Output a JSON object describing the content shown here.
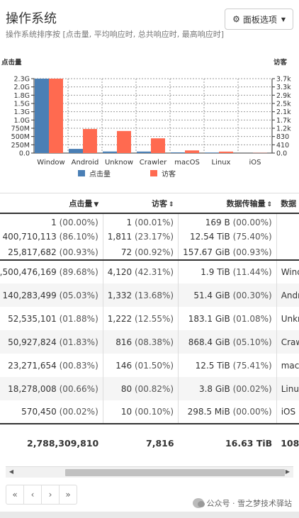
{
  "header": {
    "title": "操作系统",
    "subtitle": "操作系统排序按 [点击量, 平均响应时, 总共响应时, 最高响应时]",
    "options_label": "面板选项"
  },
  "chart_data": {
    "type": "bar",
    "categories": [
      "Window",
      "Android",
      "Unknow",
      "Crawler",
      "macOS",
      "Linux",
      "iOS"
    ],
    "series": [
      {
        "name": "点击量",
        "axis": "left",
        "color": "#4a7fb5",
        "values": [
          2500476169,
          140283499,
          52535101,
          50927824,
          23271654,
          18278008,
          570450
        ]
      },
      {
        "name": "访客",
        "axis": "right",
        "color": "#ff6a50",
        "values": [
          4120,
          1332,
          1222,
          816,
          146,
          80,
          10
        ]
      }
    ],
    "left_axis": {
      "label": "点击量",
      "ticks": [
        "0.0",
        "250M",
        "500M",
        "750M",
        "1.0G",
        "1.3G",
        "1.5G",
        "1.8G",
        "2.0G",
        "2.3G"
      ],
      "max": 2500000000
    },
    "right_axis": {
      "label": "访客",
      "ticks": [
        "0.0",
        "410",
        "830",
        "1.2k",
        "1.7k",
        "2.1k",
        "2.5k",
        "2.9k",
        "3.3k",
        "3.7k"
      ],
      "max": 4120
    },
    "legend_position": "bottom",
    "grid": true
  },
  "table": {
    "headers": {
      "hits": "点击量",
      "visitors": "访客",
      "bandwidth": "数据传输量",
      "data": "数据"
    },
    "group_rows": [
      {
        "hits": "1",
        "hits_pct": "(00.00%)",
        "visitors": "1",
        "visitors_pct": "(00.01%)",
        "bw": "169 B",
        "bw_pct": "(00.00%)",
        "data": "—"
      },
      {
        "hits": "400,710,113",
        "hits_pct": "(86.10%)",
        "visitors": "1,811",
        "visitors_pct": "(23.17%)",
        "bw": "12.54 TiB",
        "bw_pct": "(75.40%)",
        "data": "—"
      },
      {
        "hits": "25,817,682",
        "hits_pct": "(00.93%)",
        "visitors": "72",
        "visitors_pct": "(00.92%)",
        "bw": "157.67 GiB",
        "bw_pct": "(00.93%)",
        "data": "—"
      }
    ],
    "rows": [
      {
        "hits": "2,500,476,169",
        "hits_pct": "(89.68%)",
        "visitors": "4,120",
        "visitors_pct": "(42.31%)",
        "bw": "1.9 TiB",
        "bw_pct": "(11.44%)",
        "os": "Windows"
      },
      {
        "hits": "140,283,499",
        "hits_pct": "(05.03%)",
        "visitors": "1,332",
        "visitors_pct": "(13.68%)",
        "bw": "51.4 GiB",
        "bw_pct": "(00.30%)",
        "os": "Android"
      },
      {
        "hits": "52,535,101",
        "hits_pct": "(01.88%)",
        "visitors": "1,222",
        "visitors_pct": "(12.55%)",
        "bw": "183.1 GiB",
        "bw_pct": "(01.08%)",
        "os": "Unknown"
      },
      {
        "hits": "50,927,824",
        "hits_pct": "(01.83%)",
        "visitors": "816",
        "visitors_pct": "(08.38%)",
        "bw": "868.4 GiB",
        "bw_pct": "(05.10%)",
        "os": "Crawlers"
      },
      {
        "hits": "23,271,654",
        "hits_pct": "(00.83%)",
        "visitors": "146",
        "visitors_pct": "(01.50%)",
        "bw": "12.5 TiB",
        "bw_pct": "(75.41%)",
        "os": "macOS"
      },
      {
        "hits": "18,278,008",
        "hits_pct": "(00.66%)",
        "visitors": "80",
        "visitors_pct": "(00.82%)",
        "bw": "3.8 GiB",
        "bw_pct": "(00.02%)",
        "os": "Linux"
      },
      {
        "hits": "570,450",
        "hits_pct": "(00.02%)",
        "visitors": "10",
        "visitors_pct": "(00.10%)",
        "bw": "298.5 MiB",
        "bw_pct": "(00.00%)",
        "os": "iOS"
      }
    ],
    "totals": {
      "hits": "2,788,309,810",
      "visitors": "7,816",
      "bw": "16.63 TiB",
      "data": "108"
    }
  },
  "pagination": {
    "first": "«",
    "prev": "‹",
    "next": "›",
    "last": "»"
  },
  "watermark": "公众号 · 雪之梦技术驿站"
}
